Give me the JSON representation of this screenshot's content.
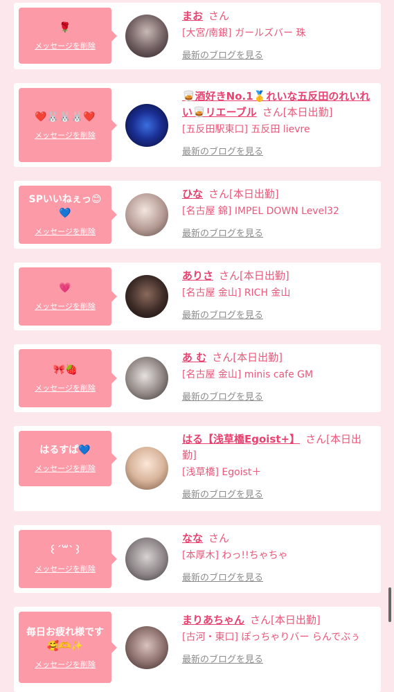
{
  "common": {
    "delete_label": "メッセージを削除",
    "blog_label": "最新のブログを見る"
  },
  "items": [
    {
      "message": "🌹",
      "name": "まお",
      "suffix": "さん",
      "location": "[大宮/南銀] ガールズバー 珠"
    },
    {
      "message": "❤️🐰🐰🐰❤️",
      "name": "🥃酒好きNo.1🥇れいな五反田のれいれい🥃リエーブル",
      "suffix": "さん[本日出勤]",
      "location": "[五反田駅東口] 五反田 lievre"
    },
    {
      "message": "SPいいねぇっ😊💙",
      "name": "ひな",
      "suffix": "さん[本日出勤]",
      "location": "[名古屋 錦] IMPEL DOWN Level32"
    },
    {
      "message": "💗",
      "name": "ありさ",
      "suffix": "さん[本日出勤]",
      "location": "[名古屋 金山] RICH 金山"
    },
    {
      "message": "🎀🍓",
      "name": "あ む",
      "suffix": "さん[本日出勤]",
      "location": "[名古屋 金山] minis cafe GM"
    },
    {
      "message": "はるすぱ💙",
      "name": "はる【浅草橋Egoist+】",
      "suffix": "さん[本日出勤]",
      "location": "[浅草橋] Egoist＋"
    },
    {
      "message": "꒰´꒳`꒱",
      "name": "なな",
      "suffix": "さん",
      "location": "[本厚木] わっ!!ちゃちゃ"
    },
    {
      "message": "毎日お疲れ様です🥰🫶✨",
      "name": "まりあちゃん",
      "suffix": "さん[本日出勤]",
      "location": "[古河・東口] ぽっちゃりバー らんでぶぅ"
    }
  ],
  "colors": {
    "page_bg": "#fbe7ec",
    "bubble_bg": "#fd9aa8",
    "name_color": "#e8416f",
    "text_color": "#e8587a",
    "link_gray": "#8b8b8b"
  }
}
